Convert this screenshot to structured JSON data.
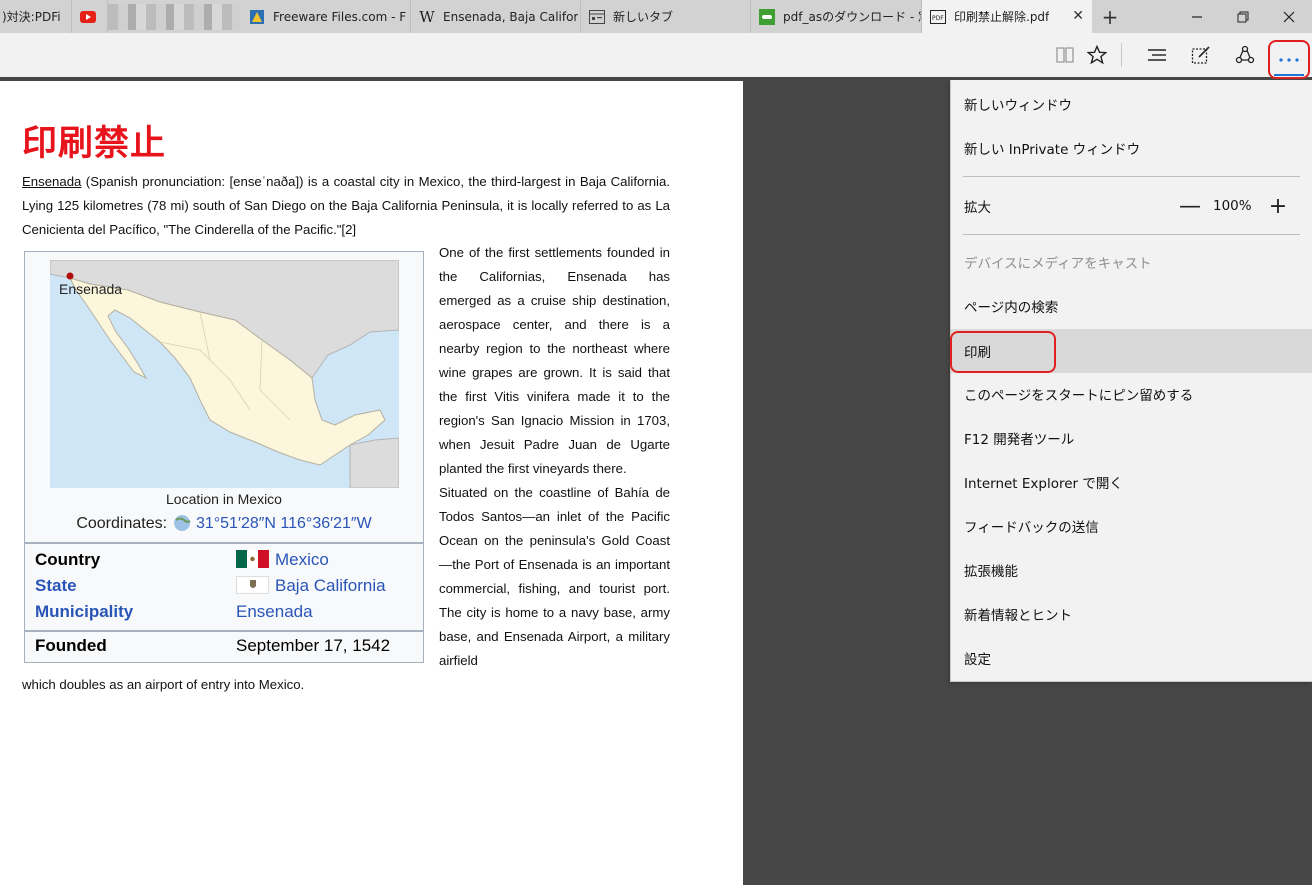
{
  "tabs": [
    {
      "label": ")対決:PDFi",
      "icon": "generic-page-icon",
      "active": false
    },
    {
      "label": "",
      "icon": "youtube-icon",
      "active": false
    },
    {
      "label": "Freeware Files.com - F",
      "icon": "freeware-icon",
      "active": false
    },
    {
      "label": "Ensenada, Baja Califor",
      "icon": "wikipedia-icon",
      "active": false
    },
    {
      "label": "新しいタブ",
      "icon": "new-tab-page-icon",
      "active": false
    },
    {
      "label": "pdf_asのダウンロード - 窓",
      "icon": "green-site-icon",
      "active": false
    },
    {
      "label": "印刷禁止解除.pdf",
      "icon": "pdf-icon",
      "active": true
    }
  ],
  "pdf": {
    "title": "印刷禁止",
    "intro_link": "Ensenada",
    "intro_rest": " (Spanish pronunciation: [enseˈnaða]) is a coastal city in Mexico, the third-largest in Baja California. Lying 125 kilometres (78 mi) south of San Diego on the Baja California Peninsula, it is locally referred to as La Cenicienta del Pacífico, \"The Cinderella of the Pacific.\"[2]",
    "side_text_1": "One of the first settlements founded in the Californias, Ensenada has emerged as a cruise ship destination, aerospace center, and there is a nearby region to the northeast where wine grapes are grown. It is said that the first Vitis vinifera made it to the region's San Ignacio Mission in 1703, when Jesuit Padre Juan de Ugarte planted the first vineyards there.",
    "side_text_2": "Situated on the coastline of Bahía de Todos Santos—an inlet of the Pacific Ocean on the peninsula's Gold Coast—the Port of Ensenada is an important commercial, fishing, and tourist port. The city is home to a navy base, army base, and Ensenada Airport, a military airfield",
    "tail_text": "which doubles as an airport of entry into Mexico.",
    "infobox": {
      "map_label": "Ensenada",
      "caption": "Location in Mexico",
      "coords_label": "Coordinates:",
      "coords_value": "31°51′28″N 116°36′21″W",
      "rows": [
        {
          "label": "Country",
          "value": "Mexico"
        },
        {
          "label": "State",
          "value": "Baja California"
        },
        {
          "label": "Municipality",
          "value": "Ensenada"
        },
        {
          "label": "Founded",
          "value": "September 17, 1542"
        }
      ]
    }
  },
  "menu": {
    "new_window": "新しいウィンドウ",
    "new_inprivate": "新しい InPrivate ウィンドウ",
    "zoom_label": "拡大",
    "zoom_value": "100%",
    "cast": "デバイスにメディアをキャスト",
    "find": "ページ内の検索",
    "print": "印刷",
    "pin": "このページをスタートにピン留めする",
    "devtools": "F12 開発者ツール",
    "open_ie": "Internet Explorer で開く",
    "feedback": "フィードバックの送信",
    "extensions": "拡張機能",
    "whats_new": "新着情報とヒント",
    "settings": "設定"
  },
  "colors": {
    "title_red": "#e8141b",
    "link_blue": "#2a55b8",
    "highlight_red": "#e02020",
    "accent_blue": "#1b74d7"
  }
}
